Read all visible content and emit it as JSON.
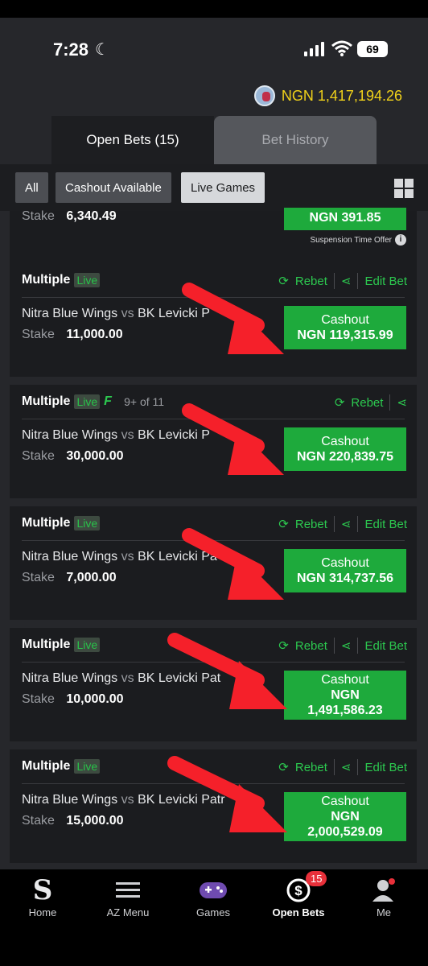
{
  "status_bar": {
    "time": "7:28",
    "battery": "69"
  },
  "balance": {
    "text": "NGN 1,417,194.26"
  },
  "tabs": [
    {
      "label": "Open Bets (15)"
    },
    {
      "label": "Bet History"
    }
  ],
  "filters": [
    {
      "label": "All"
    },
    {
      "label": "Cashout Available"
    },
    {
      "label": "Live Games"
    }
  ],
  "partial_card": {
    "stake_label": "Stake",
    "stake": "6,340.49",
    "cashout_amount": "NGN 391.85",
    "suspension_text": "Suspension Time Offer"
  },
  "actions": {
    "rebet": "Rebet",
    "edit": "Edit Bet"
  },
  "cards": [
    {
      "type": "Multiple",
      "live": "Live",
      "home": "Nitra Blue Wings",
      "vs": "vs",
      "away": "BK Levicki P",
      "stake_label": "Stake",
      "stake": "11,000.00",
      "cashout_label": "Cashout",
      "cashout_amount": "NGN 119,315.99"
    },
    {
      "type": "Multiple",
      "live": "Live",
      "extra": "9+ of 11",
      "home": "Nitra Blue Wings",
      "vs": "vs",
      "away": "BK Levicki P",
      "stake_label": "Stake",
      "stake": "30,000.00",
      "cashout_label": "Cashout",
      "cashout_amount": "NGN 220,839.75"
    },
    {
      "type": "Multiple",
      "live": "Live",
      "home": "Nitra Blue Wings",
      "vs": "vs",
      "away": "BK Levicki Pa",
      "stake_label": "Stake",
      "stake": "7,000.00",
      "cashout_label": "Cashout",
      "cashout_amount": "NGN 314,737.56"
    },
    {
      "type": "Multiple",
      "live": "Live",
      "home": "Nitra Blue Wings",
      "vs": "vs",
      "away": "BK Levicki Pat",
      "stake_label": "Stake",
      "stake": "10,000.00",
      "cashout_label": "Cashout",
      "cashout_currency": "NGN",
      "cashout_value": "1,491,586.23"
    },
    {
      "type": "Multiple",
      "live": "Live",
      "home": "Nitra Blue Wings",
      "vs": "vs",
      "away": "BK Levicki Patr",
      "stake_label": "Stake",
      "stake": "15,000.00",
      "cashout_label": "Cashout",
      "cashout_currency": "NGN",
      "cashout_value": "2,000,529.09"
    }
  ],
  "nav": [
    {
      "label": "Home",
      "icon": "sportybet-logo-icon"
    },
    {
      "label": "AZ Menu",
      "icon": "hamburger-icon"
    },
    {
      "label": "Games",
      "icon": "gamepad-icon"
    },
    {
      "label": "Open Bets",
      "icon": "open-bets-icon",
      "badge": "15"
    },
    {
      "label": "Me",
      "icon": "user-icon"
    }
  ],
  "colors": {
    "accent": "#1eaa3c",
    "balance": "#f1d21a",
    "badge": "#e8303a",
    "annotation_arrow": "#f5202a"
  }
}
